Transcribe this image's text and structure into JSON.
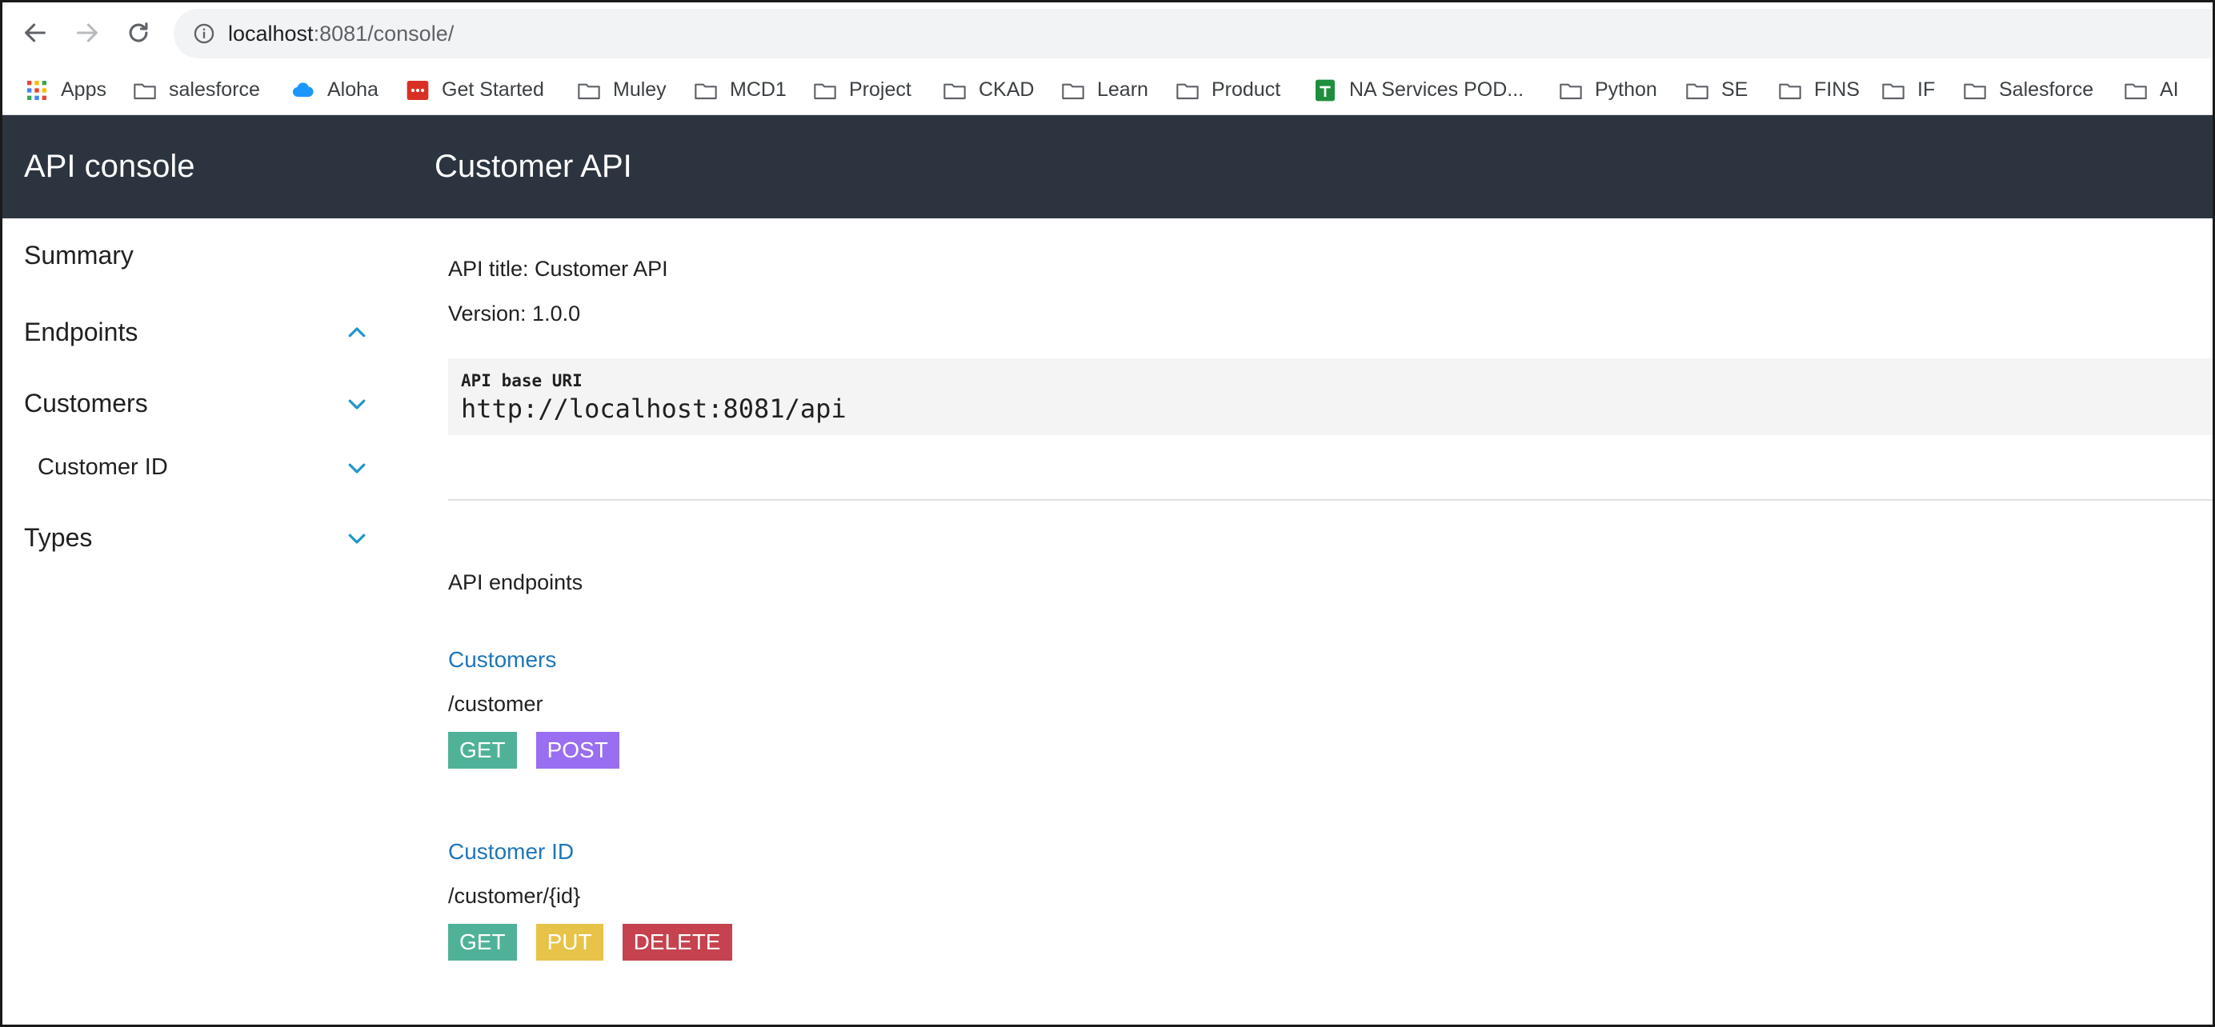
{
  "browser": {
    "url_host": "localhost",
    "url_rest": ":8081/console/",
    "bookmarks": [
      {
        "label": "Apps",
        "icon": "apps-grid-icon"
      },
      {
        "label": "salesforce",
        "icon": "folder-icon"
      },
      {
        "label": "Aloha",
        "icon": "cloud-icon"
      },
      {
        "label": "Get Started",
        "icon": "get-started-icon"
      },
      {
        "label": "Muley",
        "icon": "folder-icon"
      },
      {
        "label": "MCD1",
        "icon": "folder-icon"
      },
      {
        "label": "Project",
        "icon": "folder-icon"
      },
      {
        "label": "CKAD",
        "icon": "folder-icon"
      },
      {
        "label": "Learn",
        "icon": "folder-icon"
      },
      {
        "label": "Product",
        "icon": "folder-icon"
      },
      {
        "label": "NA Services POD...",
        "icon": "sheets-icon"
      },
      {
        "label": "Python",
        "icon": "folder-icon"
      },
      {
        "label": "SE",
        "icon": "folder-icon"
      },
      {
        "label": "FINS",
        "icon": "folder-icon"
      },
      {
        "label": "IF",
        "icon": "folder-icon"
      },
      {
        "label": "Salesforce",
        "icon": "folder-icon"
      },
      {
        "label": "AI",
        "icon": "folder-icon"
      }
    ]
  },
  "header": {
    "app_title": "API console",
    "api_name": "Customer API"
  },
  "sidebar": {
    "items": [
      {
        "label": "Summary"
      },
      {
        "label": "Endpoints",
        "expanded": true
      },
      {
        "label": "Customers",
        "expanded": false
      },
      {
        "label": "Customer ID",
        "expanded": false
      },
      {
        "label": "Types",
        "expanded": false
      }
    ]
  },
  "main": {
    "api_title": "API title: Customer API",
    "version": "Version: 1.0.0",
    "base_uri_label": "API base URI",
    "base_uri": "http://localhost:8081/api",
    "endpoints_title": "API endpoints",
    "endpoints": [
      {
        "name": "Customers",
        "path": "/customer",
        "methods": [
          {
            "label": "GET",
            "color": "#4fb298"
          },
          {
            "label": "POST",
            "color": "#9a6ef0"
          }
        ]
      },
      {
        "name": "Customer ID",
        "path": "/customer/{id}",
        "methods": [
          {
            "label": "GET",
            "color": "#4fb298"
          },
          {
            "label": "PUT",
            "color": "#e8c34a"
          },
          {
            "label": "DELETE",
            "color": "#c6424f"
          }
        ]
      }
    ]
  },
  "colors": {
    "header_bg": "#2c353f",
    "link": "#1f76b7",
    "chevron": "#2196c9"
  }
}
